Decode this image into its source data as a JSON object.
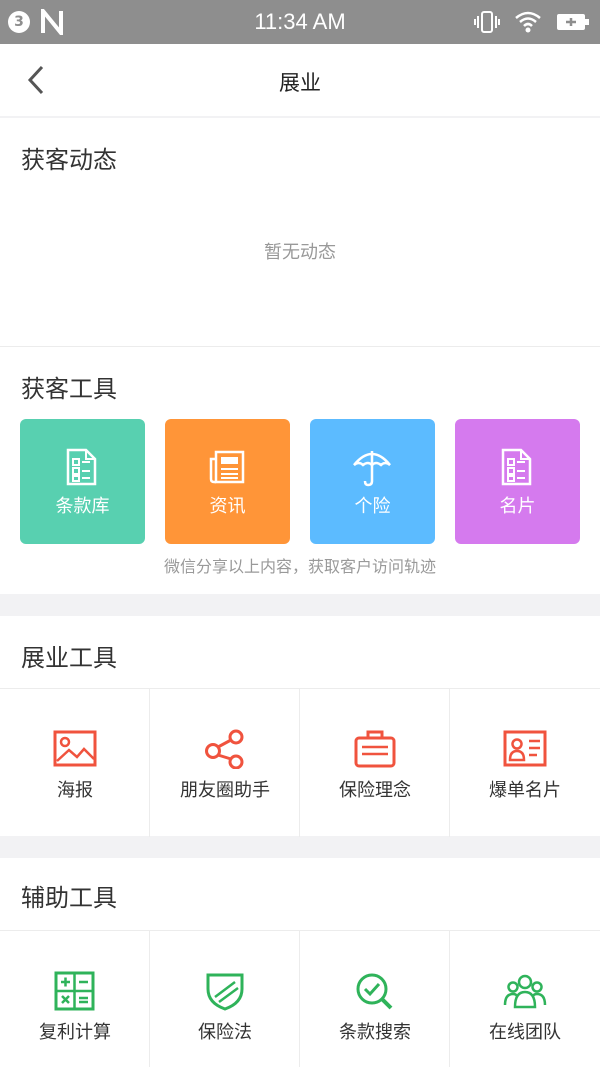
{
  "status_bar": {
    "badge": "3",
    "time": "11:34 AM"
  },
  "nav": {
    "title": "展业"
  },
  "dynamics": {
    "title": "获客动态",
    "empty_text": "暂无动态"
  },
  "acquisition_tools": {
    "title": "获客工具",
    "hint": "微信分享以上内容，获取客户访问轨迹",
    "items": [
      {
        "label": "条款库",
        "color": "#58d0b0",
        "icon": "clause-doc-icon"
      },
      {
        "label": "资讯",
        "color": "#ff9538",
        "icon": "newspaper-icon"
      },
      {
        "label": "个险",
        "color": "#5cbbff",
        "icon": "umbrella-icon"
      },
      {
        "label": "名片",
        "color": "#d57aee",
        "icon": "card-doc-icon"
      }
    ]
  },
  "business_tools": {
    "title": "展业工具",
    "accent": "#f0533e",
    "items": [
      {
        "label": "海报",
        "icon": "image-icon"
      },
      {
        "label": "朋友圈助手",
        "icon": "share-icon"
      },
      {
        "label": "保险理念",
        "icon": "briefcase-icon"
      },
      {
        "label": "爆单名片",
        "icon": "id-card-icon"
      }
    ]
  },
  "aux_tools": {
    "title": "辅助工具",
    "accent": "#2fb35a",
    "items": [
      {
        "label": "复利计算",
        "icon": "calculator-icon"
      },
      {
        "label": "保险法",
        "icon": "shield-icon"
      },
      {
        "label": "条款搜索",
        "icon": "search-check-icon"
      },
      {
        "label": "在线团队",
        "icon": "team-icon"
      }
    ]
  }
}
